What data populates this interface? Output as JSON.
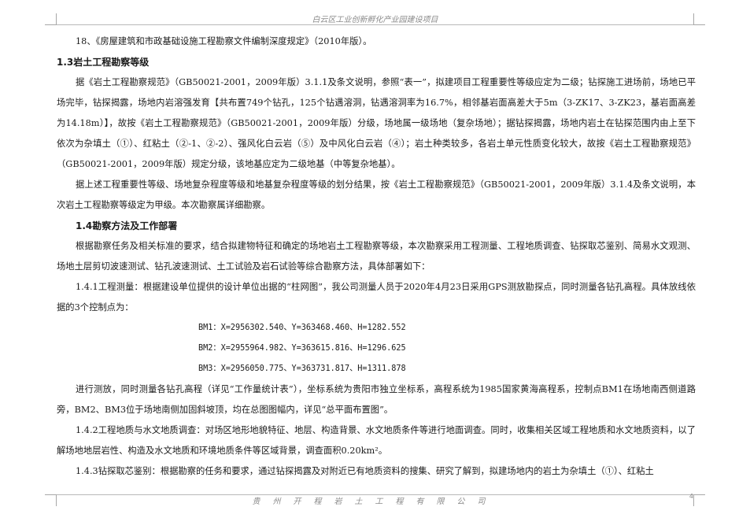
{
  "header": {
    "title": "白云区工业创新孵化产业园建设项目"
  },
  "content": {
    "item18": "18、《房屋建筑和市政基础设施工程勘察文件编制深度规定》（2010年版）。",
    "section13_title": "1.3岩土工程勘察等级",
    "section13_p1": "据《岩土工程勘察规范》（GB50021-2001，2009年版）3.1.1及条文说明，参照“表一”，拟建项目工程重要性等级应定为二级；钻探施工进场前，场地已平场完毕，钻探揭露，场地内岩溶强发育【共布置749个钻孔，125个钻遇溶洞，钻遇溶洞率为16.7%，相邻基岩面高差大于5m（3-ZK17、3-ZK23，基岩面高差为14.18m）】，故按《岩土工程勘察规范》（GB50021-2001，2009年版）分级，场地属一级场地（复杂场地）；据钻探揭露，场地内岩土在钻探范围内由上至下依次为杂填土（①）、红粘土（②-1、②-2）、强风化白云岩（⑤）及中风化白云岩（④）；岩土种类较多，各岩土单元性质变化较大，故按《岩土工程勘察规范》（GB50021-2001，2009年版）规定分级，该地基应定为二级地基（中等复杂地基）。",
    "section13_p2": "据上述工程重要性等级、场地复杂程度等级和地基复杂程度等级的划分结果，按《岩土工程勘察规范》（GB50021-2001，2009年版）3.1.4及条文说明，本次岩土工程勘察等级定为甲级。本次勘察属详细勘察。",
    "section14_title": "1.4勘察方法及工作部署",
    "section14_p1": "根据勘察任务及相关标准的要求，结合拟建物特征和确定的场地岩土工程勘察等级，本次勘察采用工程测量、工程地质调查、钻探取芯鉴别、简易水文观测、场地土层剪切波速测试、钻孔波速测试、土工试验及岩石试验等综合勘察方法，具体部署如下：",
    "section141_p1": "1.4.1工程测量：根据建设单位提供的设计单位出据的“柱网图”，我公司测量人员于2020年4月23日采用GPS测放勘探点，同时测量各钻孔高程。具体放线依据的3个控制点为：",
    "bm1": "BM1：X=2956302.540、Y=363468.460、H=1282.552",
    "bm2": "BM2：X=2955964.982、Y=363615.816、H=1296.625",
    "bm3": "BM3：X=2956050.775、Y=363731.817、H=1311.878",
    "section141_p2": "进行测放，同时测量各钻孔高程（详见“工作量统计表”），坐标系统为贵阳市独立坐标系，高程系统为1985国家黄海高程系，控制点BM1在场地南西侧道路旁，BM2、BM3位于场地南侧加固斜坡顶，均在总图图幅内，详见“总平面布置图”。",
    "section142_p1": "1.4.2工程地质与水文地质调查：对场区地形地貌特征、地层、构造背景、水文地质条件等进行地面调查。同时，收集相关区域工程地质和水文地质资料，以了解场地地层岩性、构造及水文地质和环境地质条件等区域背景，调查面积0.20km²。",
    "section143_p1": "1.4.3钻探取芯鉴别：根据勘察的任务和要求，通过钻探揭露及对附近已有地质资料的搜集、研究了解到，拟建场地内的岩土为杂填土（①）、红粘土"
  },
  "footer": {
    "company": "贵州开程岩土工程有限公司",
    "page_number": "4"
  }
}
